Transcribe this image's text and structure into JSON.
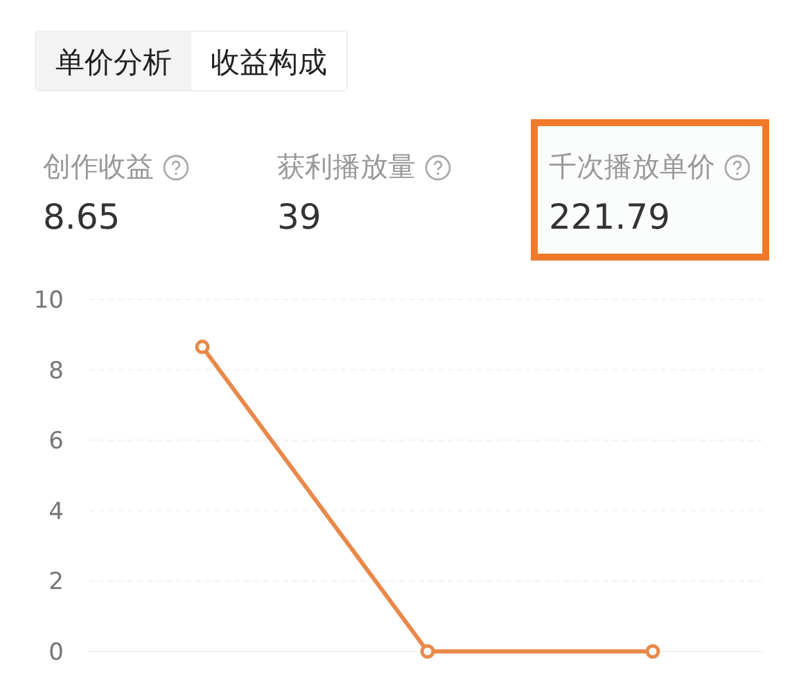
{
  "tabs": [
    {
      "label": "单价分析",
      "selected": true
    },
    {
      "label": "收益构成",
      "selected": false
    }
  ],
  "stats": [
    {
      "label": "创作收益",
      "value": "8.65",
      "highlighted": false
    },
    {
      "label": "获利播放量",
      "value": "39",
      "highlighted": false
    },
    {
      "label": "千次播放单价",
      "value": "221.79",
      "highlighted": true
    }
  ],
  "chart_data": {
    "type": "line",
    "grid": true,
    "ylim": [
      0,
      10
    ],
    "yticks": [
      0,
      2,
      4,
      6,
      8,
      10
    ],
    "series": [
      {
        "color": "#e8894a",
        "marker": "circle",
        "values": [
          8.65,
          0,
          0
        ]
      }
    ]
  }
}
